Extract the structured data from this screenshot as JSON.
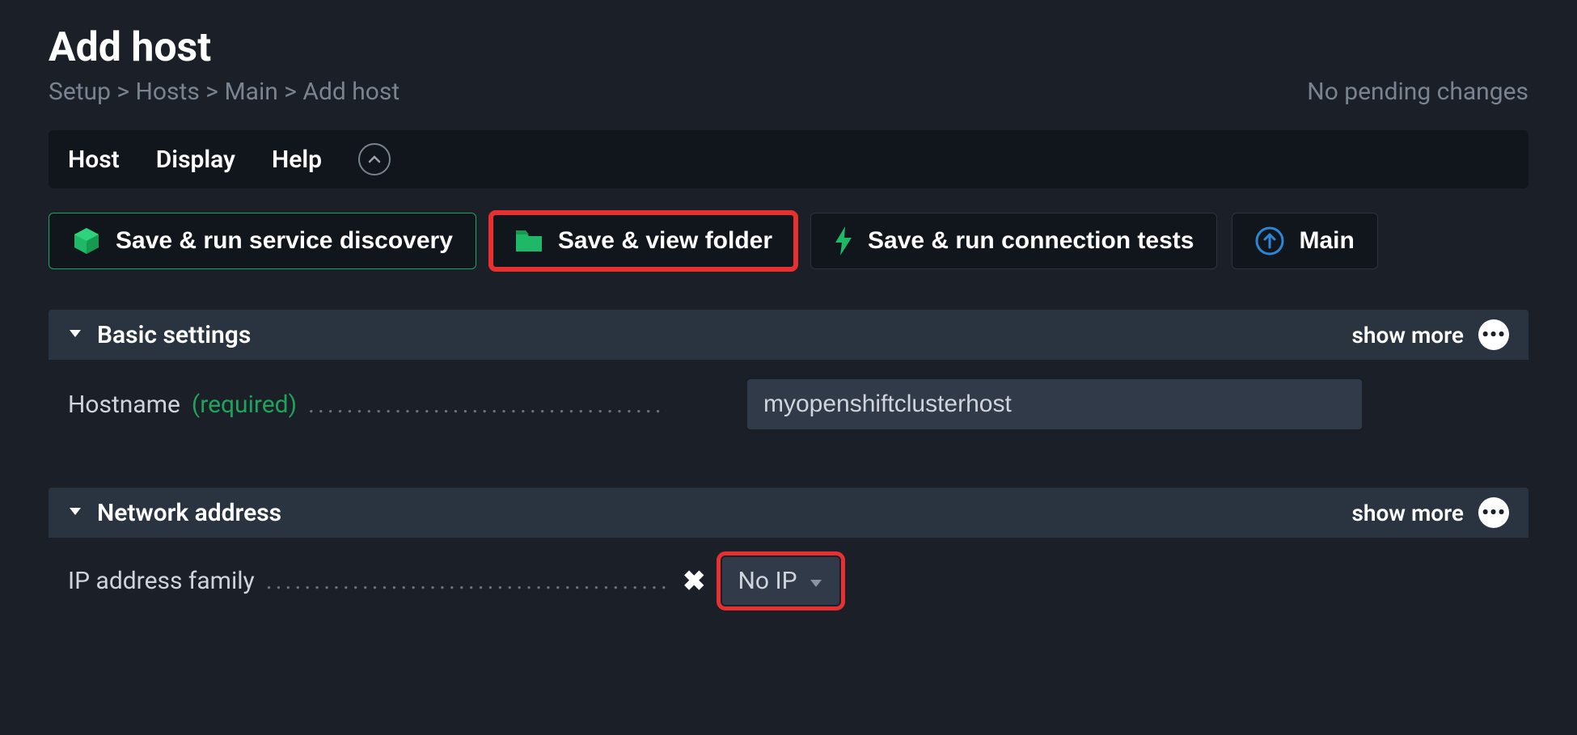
{
  "page": {
    "title": "Add host",
    "pending_status": "No pending changes"
  },
  "breadcrumb": {
    "items": [
      "Setup",
      "Hosts",
      "Main",
      "Add host"
    ],
    "separator": ">"
  },
  "menu": {
    "host": "Host",
    "display": "Display",
    "help": "Help"
  },
  "actions": {
    "save_discovery": "Save & run service discovery",
    "save_folder": "Save & view folder",
    "save_tests": "Save & run connection tests",
    "main": "Main"
  },
  "sections": {
    "basic": {
      "title": "Basic settings",
      "show_more": "show more",
      "hostname_label": "Hostname",
      "hostname_required": "(required)",
      "hostname_value": "myopenshiftclusterhost"
    },
    "network": {
      "title": "Network address",
      "show_more": "show more",
      "ip_family_label": "IP address family",
      "ip_family_value": "No IP"
    }
  }
}
